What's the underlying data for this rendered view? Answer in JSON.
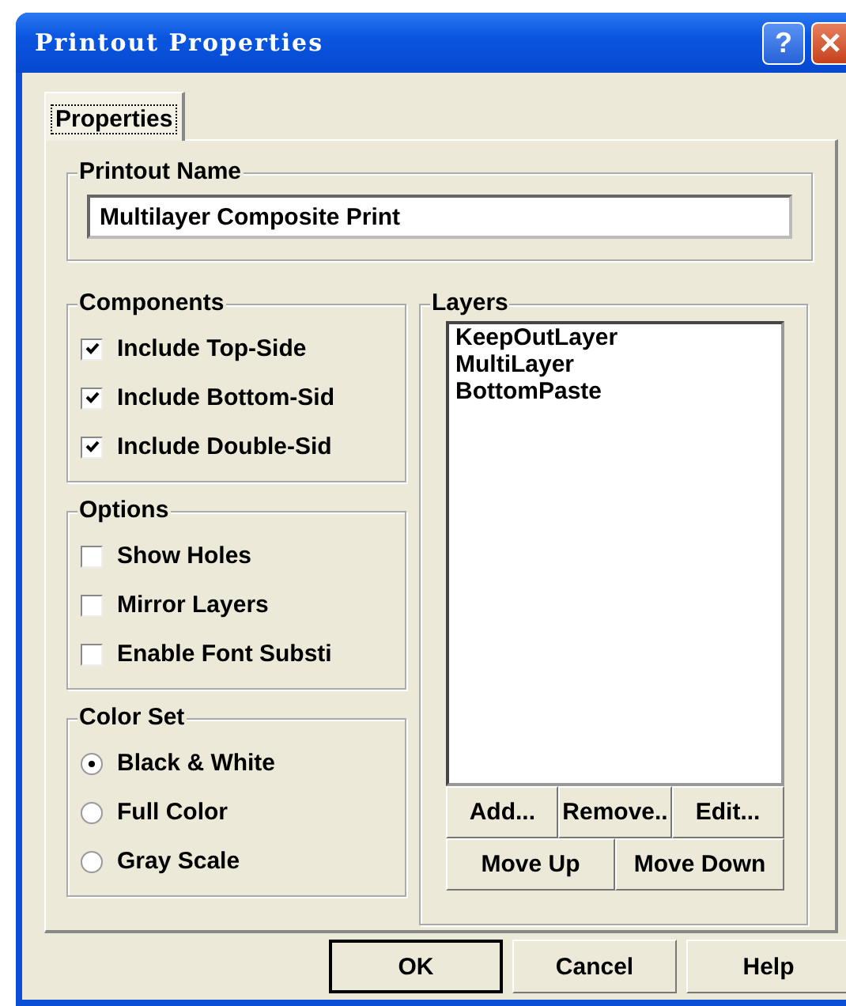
{
  "window": {
    "title": "Printout Properties",
    "help_button": {
      "label": "?"
    }
  },
  "tabs": [
    {
      "label": "Properties",
      "selected": true
    }
  ],
  "printout_name": {
    "label": "Printout Name",
    "value": "Multilayer Composite Print"
  },
  "components": {
    "label": "Components",
    "items": [
      {
        "label": "Include Top-Side",
        "checked": true
      },
      {
        "label": "Include Bottom-Sid",
        "checked": true
      },
      {
        "label": "Include Double-Sid",
        "checked": true
      }
    ]
  },
  "options": {
    "label": "Options",
    "items": [
      {
        "label": "Show Holes",
        "checked": false
      },
      {
        "label": "Mirror Layers",
        "checked": false
      },
      {
        "label": "Enable Font Substi",
        "checked": false
      }
    ]
  },
  "color_set": {
    "label": "Color Set",
    "items": [
      {
        "label": "Black & White",
        "selected": true
      },
      {
        "label": "Full Color",
        "selected": false
      },
      {
        "label": "Gray Scale",
        "selected": false
      }
    ]
  },
  "layers": {
    "label": "Layers",
    "items": [
      "KeepOutLayer",
      "MultiLayer",
      "BottomPaste"
    ],
    "button_rows": [
      [
        {
          "label": "Add..."
        },
        {
          "label": "Remove.."
        },
        {
          "label": "Edit..."
        }
      ],
      [
        {
          "label": "Move Up"
        },
        {
          "label": "Move Down"
        }
      ]
    ]
  },
  "dialog_buttons": [
    {
      "label": "OK",
      "default": true
    },
    {
      "label": "Cancel",
      "default": false
    },
    {
      "label": "Help",
      "default": false
    }
  ]
}
